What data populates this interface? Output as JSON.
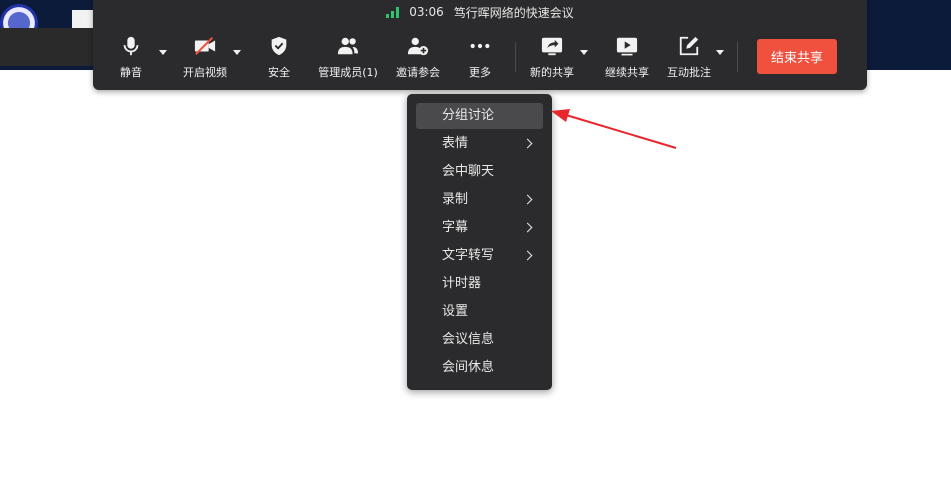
{
  "meeting": {
    "time": "03:06",
    "title": "笃行晖网络的快速会议"
  },
  "toolbar": {
    "buttons": [
      {
        "label": "静音",
        "icon": "microphone-icon"
      },
      {
        "label": "开启视频",
        "icon": "video-off-icon"
      },
      {
        "label": "安全",
        "icon": "shield-icon"
      },
      {
        "label": "管理成员(1)",
        "icon": "members-icon"
      },
      {
        "label": "邀请参会",
        "icon": "add-user-icon"
      },
      {
        "label": "更多",
        "icon": "more-icon"
      },
      {
        "label": "新的共享",
        "icon": "share-icon"
      },
      {
        "label": "继续共享",
        "icon": "play-screen-icon"
      },
      {
        "label": "互动批注",
        "icon": "annotate-icon"
      }
    ],
    "end_label": "结束共享"
  },
  "menu": {
    "items": [
      {
        "label": "分组讨论",
        "active": true,
        "submenu": false
      },
      {
        "label": "表情",
        "submenu": true
      },
      {
        "label": "会中聊天",
        "submenu": false
      },
      {
        "label": "录制",
        "submenu": true
      },
      {
        "label": "字幕",
        "submenu": true
      },
      {
        "label": "文字转写",
        "submenu": true
      },
      {
        "label": "计时器",
        "submenu": false
      },
      {
        "label": "设置",
        "submenu": false
      },
      {
        "label": "会议信息",
        "submenu": false
      },
      {
        "label": "会间休息",
        "submenu": false
      }
    ]
  },
  "colors": {
    "toolbar_bg": "#2b2b2d",
    "end_button": "#f0513f",
    "signal": "#2ec46f",
    "annotation_arrow": "#e8262c"
  }
}
